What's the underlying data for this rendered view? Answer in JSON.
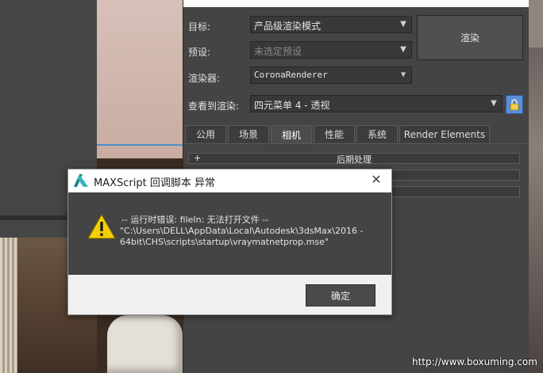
{
  "render_setup": {
    "target_label": "目标:",
    "target_value": "产品级渲染模式",
    "preset_label": "预设:",
    "preset_placeholder": "未选定预设",
    "renderer_label": "渲染器:",
    "renderer_value": "CoronaRenderer",
    "view_label": "查看到渲染:",
    "view_value": "四元菜单 4 - 透视",
    "render_button": "渲染",
    "tabs": [
      {
        "label": "公用"
      },
      {
        "label": "场景"
      },
      {
        "label": "相机"
      },
      {
        "label": "性能"
      },
      {
        "label": "系统"
      },
      {
        "label": "Render Elements"
      }
    ],
    "active_tab": "相机",
    "rollouts": [
      {
        "sign": "+",
        "title": "后期处理"
      }
    ]
  },
  "error_dialog": {
    "title": "MAXScript 回调脚本 异常",
    "message_line1": "-- 运行时错误: fileIn: 无法打开文件 --",
    "message_line2": "\"C:\\Users\\DELL\\AppData\\Local\\Autodesk\\3dsMax\\2016 -",
    "message_line3": "64bit\\CHS\\scripts\\startup\\vraymatnetprop.mse\"",
    "ok_button": "确定"
  },
  "watermark": "http://www.boxuming.com",
  "colors": {
    "panel_bg": "#444444",
    "dialog_body": "#444444",
    "lock_blue": "#5b8fd6",
    "warning_yellow": "#f5d000"
  },
  "icons": {
    "dropdown": "chevron-down-icon",
    "lock": "lock-icon",
    "close": "close-icon",
    "warning": "warning-icon",
    "logo": "3dsmax-logo-icon"
  }
}
